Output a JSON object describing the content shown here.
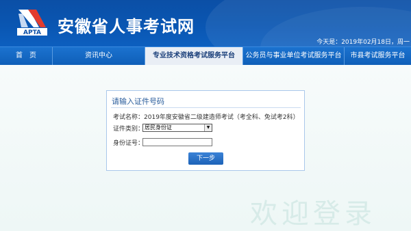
{
  "header": {
    "logo_text": "APTA",
    "site_title": "安徽省人事考试网",
    "date_line": "今天是：2019年02月18日，周一"
  },
  "nav": {
    "items": [
      {
        "label": "首　页"
      },
      {
        "label": "资讯中心"
      },
      {
        "label": "专业技术资格考试服务平台",
        "active": true
      },
      {
        "label": "公务员与事业单位考试服务平台"
      },
      {
        "label": "市县考试服务平台"
      }
    ]
  },
  "form": {
    "title": "请输入证件号码",
    "exam_label": "考试名称：",
    "exam_value": "2019年度安徽省二级建造师考试（考全科、免试考2科）",
    "id_type_label": "证件类别：",
    "id_type_selected": "居民身份证",
    "id_number_label": "身份证号：",
    "id_number_value": "",
    "next_button": "下一步"
  },
  "watermark": "欢迎登录",
  "colors": {
    "header_blue": "#0b4fa6",
    "nav_blue": "#1b72cf",
    "button_blue": "#1d63b8",
    "panel_border": "#a9c7ea"
  }
}
